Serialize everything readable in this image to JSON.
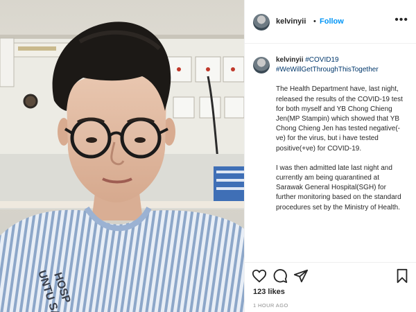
{
  "header": {
    "username": "kelvinyii",
    "separator": "•",
    "follow_label": "Follow",
    "more_icon": "more-options-icon",
    "more_label": "•••"
  },
  "caption": {
    "username": "kelvinyii",
    "tag1": "#COVID19",
    "tag2": "#WeWillGetThroughThisTogether",
    "paragraphs": [
      "The Health Department have, last night, released the results of the COVID-19 test for both myself and YB Chong Chieng Jen(MP Stampin) which showed that YB Chong Chieng Jen has tested negative(-ve) for the virus, but i have tested positive(+ve) for COVID-19.",
      "I was then admitted late last night and currently am being quarantined at Sarawak General Hospital(SGH) for further monitoring based on the standard procedures set by the Ministry of Health."
    ]
  },
  "photo": {
    "alt": "Selfie of a man wearing glasses and a striped hospital gown in a hospital room",
    "gown_text": "UNTU SA HOSP"
  },
  "actions": {
    "like_icon": "heart-icon",
    "comment_icon": "comment-icon",
    "share_icon": "share-icon",
    "save_icon": "bookmark-icon"
  },
  "likes": "123 likes",
  "time": "1 HOUR AGO",
  "colors": {
    "link": "#00376b",
    "follow": "#0095f6",
    "text": "#262626",
    "muted": "#8e8e8e"
  }
}
